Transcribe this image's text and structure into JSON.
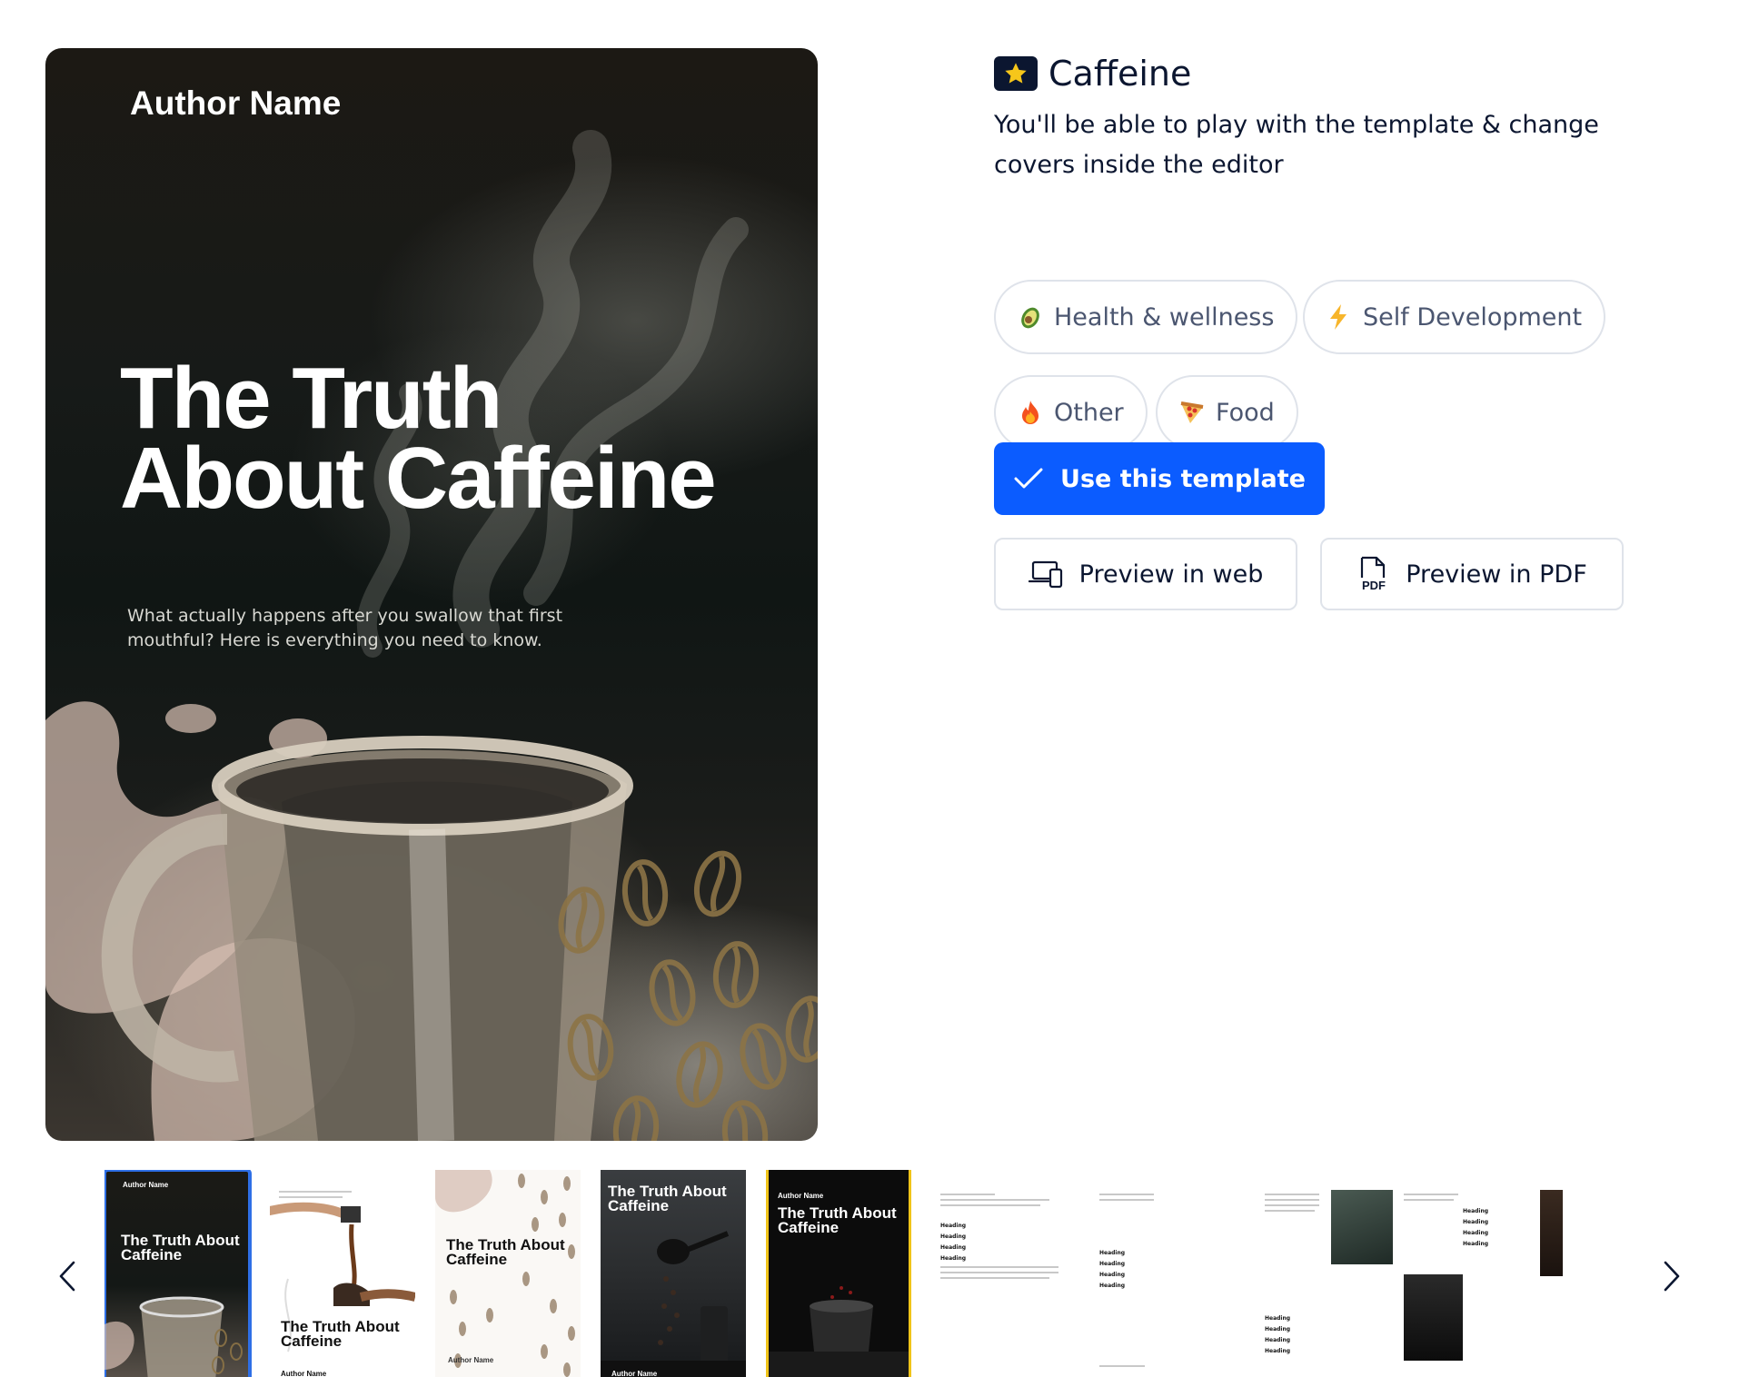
{
  "cover": {
    "author": "Author Name",
    "title_line1": "The Truth",
    "title_line2": "About Caffeine",
    "subtitle": "What actually happens after you swallow that first mouthful? Here is everything you need to know."
  },
  "panel": {
    "icon": "star-icon",
    "title": "Caffeine",
    "description": "You'll be able to play with the template & change covers inside the editor",
    "tags": [
      {
        "emoji": "avocado-icon",
        "label": "Health & wellness"
      },
      {
        "emoji": "lightning-icon",
        "label": "Self Development"
      },
      {
        "emoji": "fire-icon",
        "label": "Other"
      },
      {
        "emoji": "pizza-icon",
        "label": "Food"
      }
    ],
    "use_template_label": "Use this template",
    "preview_web_label": "Preview in web",
    "preview_pdf_label": "Preview in PDF",
    "pdf_icon_text": "PDF"
  },
  "colors": {
    "primary": "#0b5cff",
    "text": "#0b1630",
    "tag_text": "#4b5670",
    "border": "#dfe3ea",
    "selected_outline": "#2e6fe6"
  },
  "thumbnails": [
    {
      "author": "Author Name",
      "title": "The Truth About Caffeine",
      "selected": true
    },
    {
      "title": "The Truth About Caffeine",
      "author": "Author Name"
    },
    {
      "title": "The Truth About Caffeine",
      "author": "Author Name"
    },
    {
      "title": "The Truth About Caffeine",
      "author": "Author Name"
    },
    {
      "author": "Author Name",
      "title": "The Truth About Caffeine"
    }
  ],
  "spread_heading": "Heading"
}
